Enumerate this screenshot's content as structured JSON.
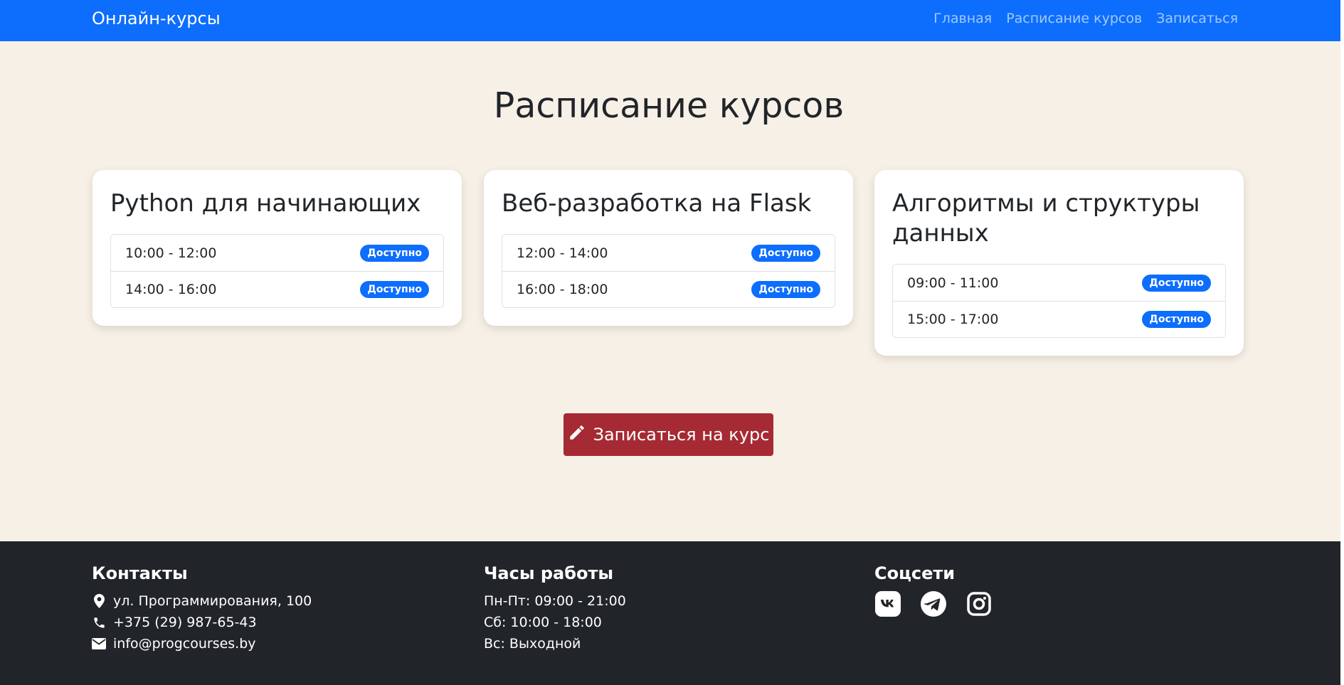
{
  "navbar": {
    "brand": "Онлайн-курсы",
    "links": [
      "Главная",
      "Расписание курсов",
      "Записаться"
    ]
  },
  "main": {
    "title": "Расписание курсов",
    "courses": [
      {
        "title": "Python для начинающих",
        "slots": [
          {
            "time": "10:00 - 12:00",
            "status": "Доступно"
          },
          {
            "time": "14:00 - 16:00",
            "status": "Доступно"
          }
        ]
      },
      {
        "title": "Веб-разработка на Flask",
        "slots": [
          {
            "time": "12:00 - 14:00",
            "status": "Доступно"
          },
          {
            "time": "16:00 - 18:00",
            "status": "Доступно"
          }
        ]
      },
      {
        "title": "Алгоритмы и структуры данных",
        "slots": [
          {
            "time": "09:00 - 11:00",
            "status": "Доступно"
          },
          {
            "time": "15:00 - 17:00",
            "status": "Доступно"
          }
        ]
      }
    ],
    "cta_label": "Записаться на курс"
  },
  "footer": {
    "contacts": {
      "heading": "Контакты",
      "address": "ул. Программирования, 100",
      "phone": "+375 (29) 987-65-43",
      "email": "info@progcourses.by"
    },
    "hours": {
      "heading": "Часы работы",
      "lines": [
        "Пн-Пт: 09:00 - 21:00",
        "Сб: 10:00 - 18:00",
        "Вс: Выходной"
      ]
    },
    "social": {
      "heading": "Соцсети",
      "icons": [
        "vk-icon",
        "telegram-icon",
        "instagram-icon"
      ]
    }
  },
  "colors": {
    "navbar": "#0d6efd",
    "main_bg": "#f7f0e6",
    "badge": "#0d6efd",
    "cta": "#a52a33",
    "footer": "#212529"
  }
}
